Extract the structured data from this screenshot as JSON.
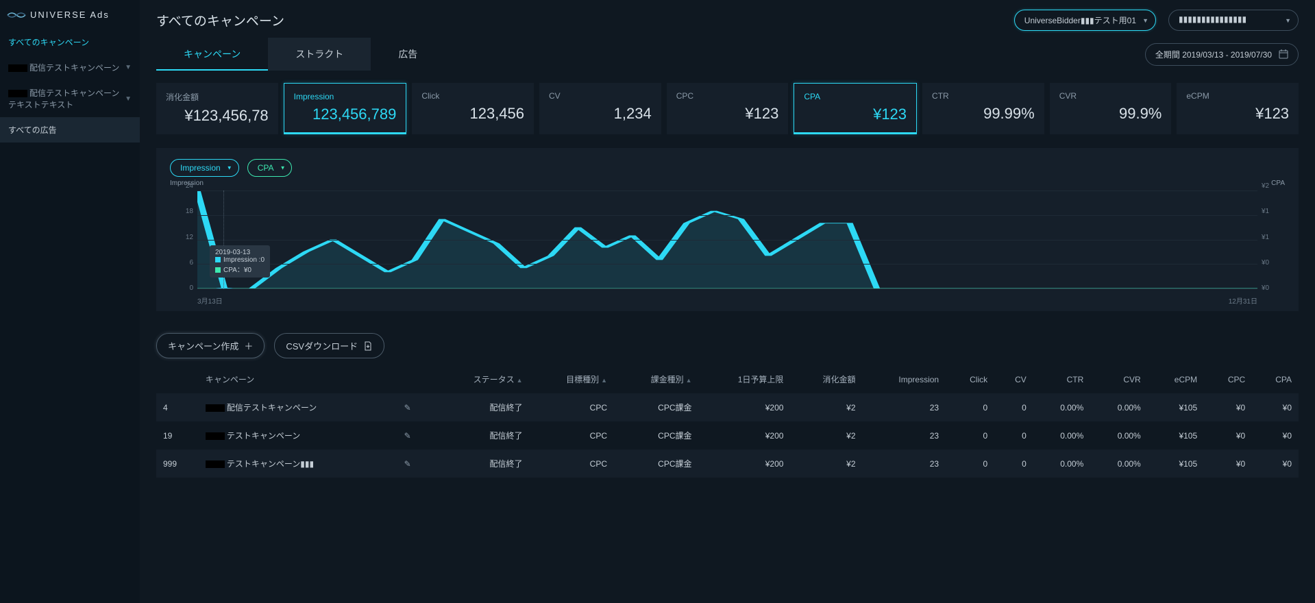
{
  "brand": "UNIVERSE Ads",
  "header": {
    "title": "すべてのキャンペーン",
    "account_selector": "UniverseBidder▮▮▮テスト用01",
    "secondary_selector": "▮▮▮▮▮▮▮▮▮▮▮▮▮▮▮",
    "date_range": "全期間 2019/03/13 - 2019/07/30"
  },
  "sidebar": {
    "items": [
      {
        "label": "すべてのキャンペーン",
        "active": true
      },
      {
        "label": "配信テストキャンペーン",
        "has_prefix_box": true,
        "expandable": true
      },
      {
        "label": "配信テストキャンペーン",
        "sublabel": "テキストテキスト",
        "has_prefix_box": true,
        "expandable": true
      },
      {
        "label": "すべての広告",
        "selected": true
      }
    ]
  },
  "tabs": [
    {
      "label": "キャンペーン",
      "state": "active"
    },
    {
      "label": "ストラクト",
      "state": "dark"
    },
    {
      "label": "広告",
      "state": ""
    }
  ],
  "metrics": [
    {
      "label": "消化金額",
      "value": "¥123,456,78",
      "active": false
    },
    {
      "label": "Impression",
      "value": "123,456,789",
      "active": true
    },
    {
      "label": "Click",
      "value": "123,456",
      "active": false
    },
    {
      "label": "CV",
      "value": "1,234",
      "active": false
    },
    {
      "label": "CPC",
      "value": "¥123",
      "active": false
    },
    {
      "label": "CPA",
      "value": "¥123",
      "active": true
    },
    {
      "label": "CTR",
      "value": "99.99%",
      "active": false
    },
    {
      "label": "CVR",
      "value": "99.9%",
      "active": false
    },
    {
      "label": "eCPM",
      "value": "¥123",
      "active": false
    }
  ],
  "chart_controls": {
    "series_a": "Impression",
    "series_b": "CPA"
  },
  "chart_data": {
    "type": "line",
    "left_axis": {
      "label": "Impression",
      "ticks": [
        "24",
        "18",
        "12",
        "6",
        "0"
      ]
    },
    "right_axis": {
      "label": "CPA",
      "ticks": [
        "¥2",
        "¥1",
        "¥1",
        "¥0",
        "¥0"
      ]
    },
    "x": [
      "3月13日",
      "12月31日"
    ],
    "xlim": [
      "2019-03-13",
      "2019-12-31"
    ],
    "series": [
      {
        "name": "Impression",
        "color": "#2dd9f5",
        "values": [
          24,
          0,
          0,
          5,
          9,
          12,
          8,
          4,
          7,
          17,
          14,
          11,
          5,
          8,
          15,
          10,
          13,
          7,
          16,
          19,
          17,
          8,
          12,
          16,
          16,
          0,
          0,
          0,
          0,
          0,
          0,
          0,
          0,
          0,
          0,
          0,
          0,
          0,
          0,
          0
        ]
      },
      {
        "name": "CPA",
        "color": "#3de8b0",
        "values": [
          0,
          0,
          0,
          0,
          0,
          0,
          0,
          0,
          0,
          0,
          0,
          0,
          0,
          0,
          0,
          0,
          0,
          0,
          0,
          0,
          0,
          0,
          0,
          0,
          0,
          0,
          0,
          0,
          0,
          0,
          0,
          0,
          0,
          0,
          0,
          0,
          0,
          0,
          0,
          0
        ]
      }
    ],
    "tooltip": {
      "date": "2019-03-13",
      "line1": "Impression :0",
      "line2": "CPA：¥0"
    }
  },
  "actions": {
    "create": "キャンペーン作成",
    "csv": "CSVダウンロード"
  },
  "table": {
    "columns": [
      "",
      "キャンペーン",
      "",
      "ステータス",
      "目標種別",
      "課金種別",
      "1日予算上限",
      "消化金額",
      "Impression",
      "Click",
      "CV",
      "CTR",
      "CVR",
      "eCPM",
      "CPC",
      "CPA"
    ],
    "rows": [
      {
        "id": "4",
        "name": "配信テストキャンペーン",
        "prefix_box": true,
        "status": "配信終了",
        "goal": "CPC",
        "billing": "CPC課金",
        "daily_cap": "¥200",
        "spent": "¥2",
        "imp": "23",
        "click": "0",
        "cv": "0",
        "ctr": "0.00%",
        "cvr": "0.00%",
        "ecpm": "¥105",
        "cpc": "¥0",
        "cpa": "¥0"
      },
      {
        "id": "19",
        "name": "テストキャンペーン",
        "prefix_box": true,
        "status": "配信終了",
        "goal": "CPC",
        "billing": "CPC課金",
        "daily_cap": "¥200",
        "spent": "¥2",
        "imp": "23",
        "click": "0",
        "cv": "0",
        "ctr": "0.00%",
        "cvr": "0.00%",
        "ecpm": "¥105",
        "cpc": "¥0",
        "cpa": "¥0"
      },
      {
        "id": "999",
        "name": "テストキャンペーン▮▮▮",
        "prefix_box": true,
        "status": "配信終了",
        "goal": "CPC",
        "billing": "CPC課金",
        "daily_cap": "¥200",
        "spent": "¥2",
        "imp": "23",
        "click": "0",
        "cv": "0",
        "ctr": "0.00%",
        "cvr": "0.00%",
        "ecpm": "¥105",
        "cpc": "¥0",
        "cpa": "¥0"
      }
    ]
  }
}
